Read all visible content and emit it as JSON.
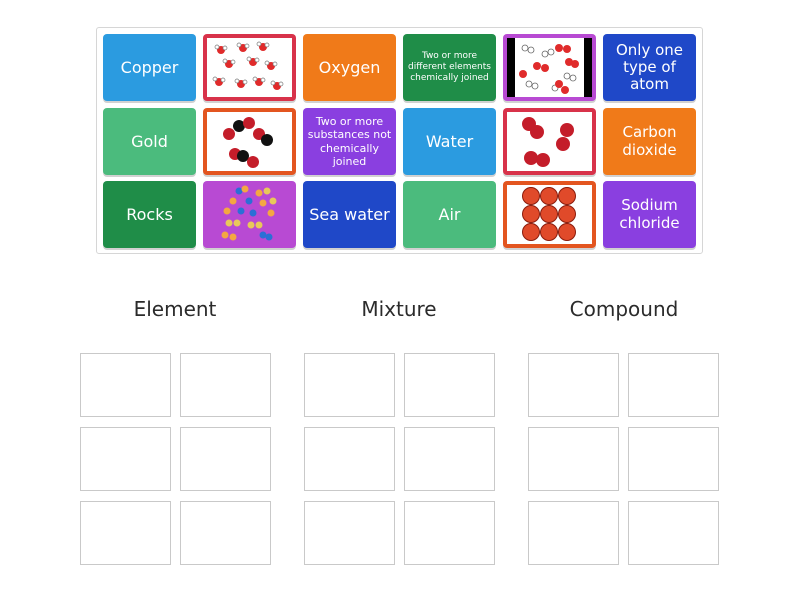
{
  "cards": {
    "copper": {
      "label": "Copper",
      "color": "#2b9be0"
    },
    "img1": {
      "border": "#d8324a",
      "icon": "water-molecules-scattered-icon"
    },
    "oxygen": {
      "label": "Oxygen",
      "color": "#f07a19"
    },
    "compound_def": {
      "label": "Two or more different elements chemically joined",
      "color": "#1f8d48"
    },
    "img2": {
      "border": "#b84ad3",
      "icon": "mixed-molecules-icon"
    },
    "element_def": {
      "label": "Only one type of atom",
      "color": "#1f48c8"
    },
    "gold": {
      "label": "Gold",
      "color": "#4bbb7d"
    },
    "img3": {
      "border": "#e35520",
      "icon": "diatomic-molecules-icon"
    },
    "mixture_def": {
      "label": "Two or more substances not chemically joined",
      "color": "#8a3fe0"
    },
    "water": {
      "label": "Water",
      "color": "#2b9be0"
    },
    "img4": {
      "border": "#d8324a",
      "icon": "red-atom-pairs-icon"
    },
    "carbon_dioxide": {
      "label": "Carbon dioxide",
      "color": "#f07a19"
    },
    "rocks": {
      "label": "Rocks",
      "color": "#1f8d48"
    },
    "img5": {
      "border": "#b84ad3",
      "icon": "multicolor-particles-icon"
    },
    "sea_water": {
      "label": "Sea water",
      "color": "#1f48c8"
    },
    "air": {
      "label": "Air",
      "color": "#4bbb7d"
    },
    "img6": {
      "border": "#e35520",
      "icon": "packed-atoms-grid-icon"
    },
    "sodium_chloride": {
      "label": "Sodium chloride",
      "color": "#8a3fe0"
    }
  },
  "groups": [
    {
      "title": "Element"
    },
    {
      "title": "Mixture"
    },
    {
      "title": "Compound"
    }
  ]
}
